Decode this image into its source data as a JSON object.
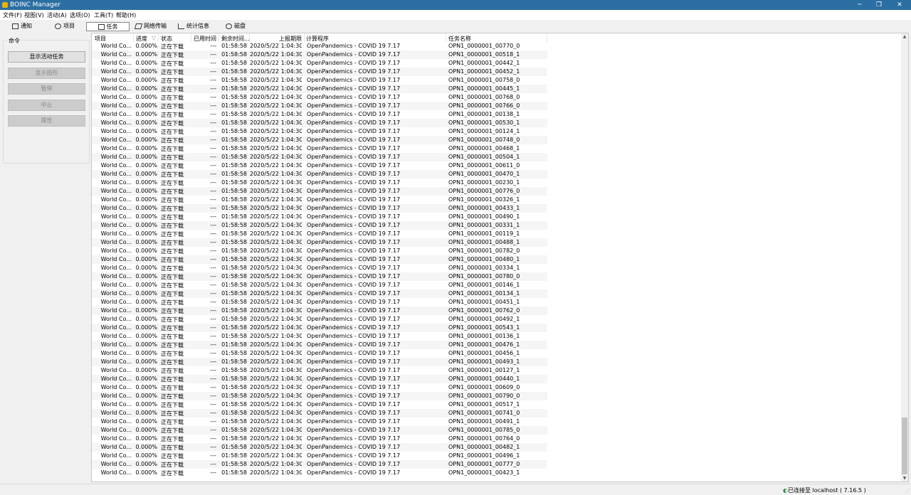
{
  "window": {
    "title": "BOINC Manager",
    "minimize": "─",
    "maximize": "❐",
    "close": "✕"
  },
  "menu": [
    "文件(F)",
    "视图(V)",
    "活动(A)",
    "选项(O)",
    "工具(T)",
    "帮助(H)"
  ],
  "tabs": [
    {
      "label": "通知",
      "icon": "envelope-icon"
    },
    {
      "label": "项目",
      "icon": "project-icon"
    },
    {
      "label": "任务",
      "icon": "task-icon",
      "active": true
    },
    {
      "label": "网络传输",
      "icon": "transfer-icon"
    },
    {
      "label": "统计信息",
      "icon": "chart-icon"
    },
    {
      "label": "磁盘",
      "icon": "disk-icon"
    }
  ],
  "commands": {
    "legend": "命令",
    "buttons": [
      {
        "label": "显示活动任务",
        "enabled": true
      },
      {
        "label": "显示图形",
        "enabled": false
      },
      {
        "label": "暂停",
        "enabled": false
      },
      {
        "label": "中止",
        "enabled": false
      },
      {
        "label": "属性",
        "enabled": false
      }
    ]
  },
  "columns": [
    "项目",
    "进度",
    "状态",
    "已用时间",
    "剩余时间...",
    "上报期限",
    "计算程序",
    "任务名称"
  ],
  "row_common": {
    "project": "World Co...",
    "progress": "0.000%",
    "status": "正在下载",
    "elapsed": "---",
    "remaining": "01:58:58",
    "deadline": "2020/5/22 1:04:30",
    "app": "OpenPandemics - COVID 19 7.17"
  },
  "task_names": [
    "OPN1_0000001_00770_0",
    "OPN1_0000001_00518_1",
    "OPN1_0000001_00442_1",
    "OPN1_0000001_00452_1",
    "OPN1_0000001_00758_0",
    "OPN1_0000001_00445_1",
    "OPN1_0000001_00768_0",
    "OPN1_0000001_00766_0",
    "OPN1_0000001_00138_1",
    "OPN1_0000001_00530_1",
    "OPN1_0000001_00124_1",
    "OPN1_0000001_00748_0",
    "OPN1_0000001_00468_1",
    "OPN1_0000001_00504_1",
    "OPN1_0000001_00611_0",
    "OPN1_0000001_00470_1",
    "OPN1_0000001_00230_1",
    "OPN1_0000001_00776_0",
    "OPN1_0000001_00326_1",
    "OPN1_0000001_00433_1",
    "OPN1_0000001_00490_1",
    "OPN1_0000001_00331_1",
    "OPN1_0000001_00119_1",
    "OPN1_0000001_00488_1",
    "OPN1_0000001_00782_0",
    "OPN1_0000001_00480_1",
    "OPN1_0000001_00334_1",
    "OPN1_0000001_00780_0",
    "OPN1_0000001_00146_1",
    "OPN1_0000001_00134_1",
    "OPN1_0000001_00451_1",
    "OPN1_0000001_00762_0",
    "OPN1_0000001_00492_1",
    "OPN1_0000001_00543_1",
    "OPN1_0000001_00136_1",
    "OPN1_0000001_00476_1",
    "OPN1_0000001_00456_1",
    "OPN1_0000001_00493_1",
    "OPN1_0000001_00127_1",
    "OPN1_0000001_00440_1",
    "OPN1_0000001_00609_0",
    "OPN1_0000001_00790_0",
    "OPN1_0000001_00517_1",
    "OPN1_0000001_00741_0",
    "OPN1_0000001_00491_1",
    "OPN1_0000001_00785_0",
    "OPN1_0000001_00764_0",
    "OPN1_0000001_00482_1",
    "OPN1_0000001_00496_1",
    "OPN1_0000001_00777_0",
    "OPN1_0000001_00423_1"
  ],
  "status_bar": {
    "connection": "已连接至 localhost ( 7.16.5 )"
  }
}
